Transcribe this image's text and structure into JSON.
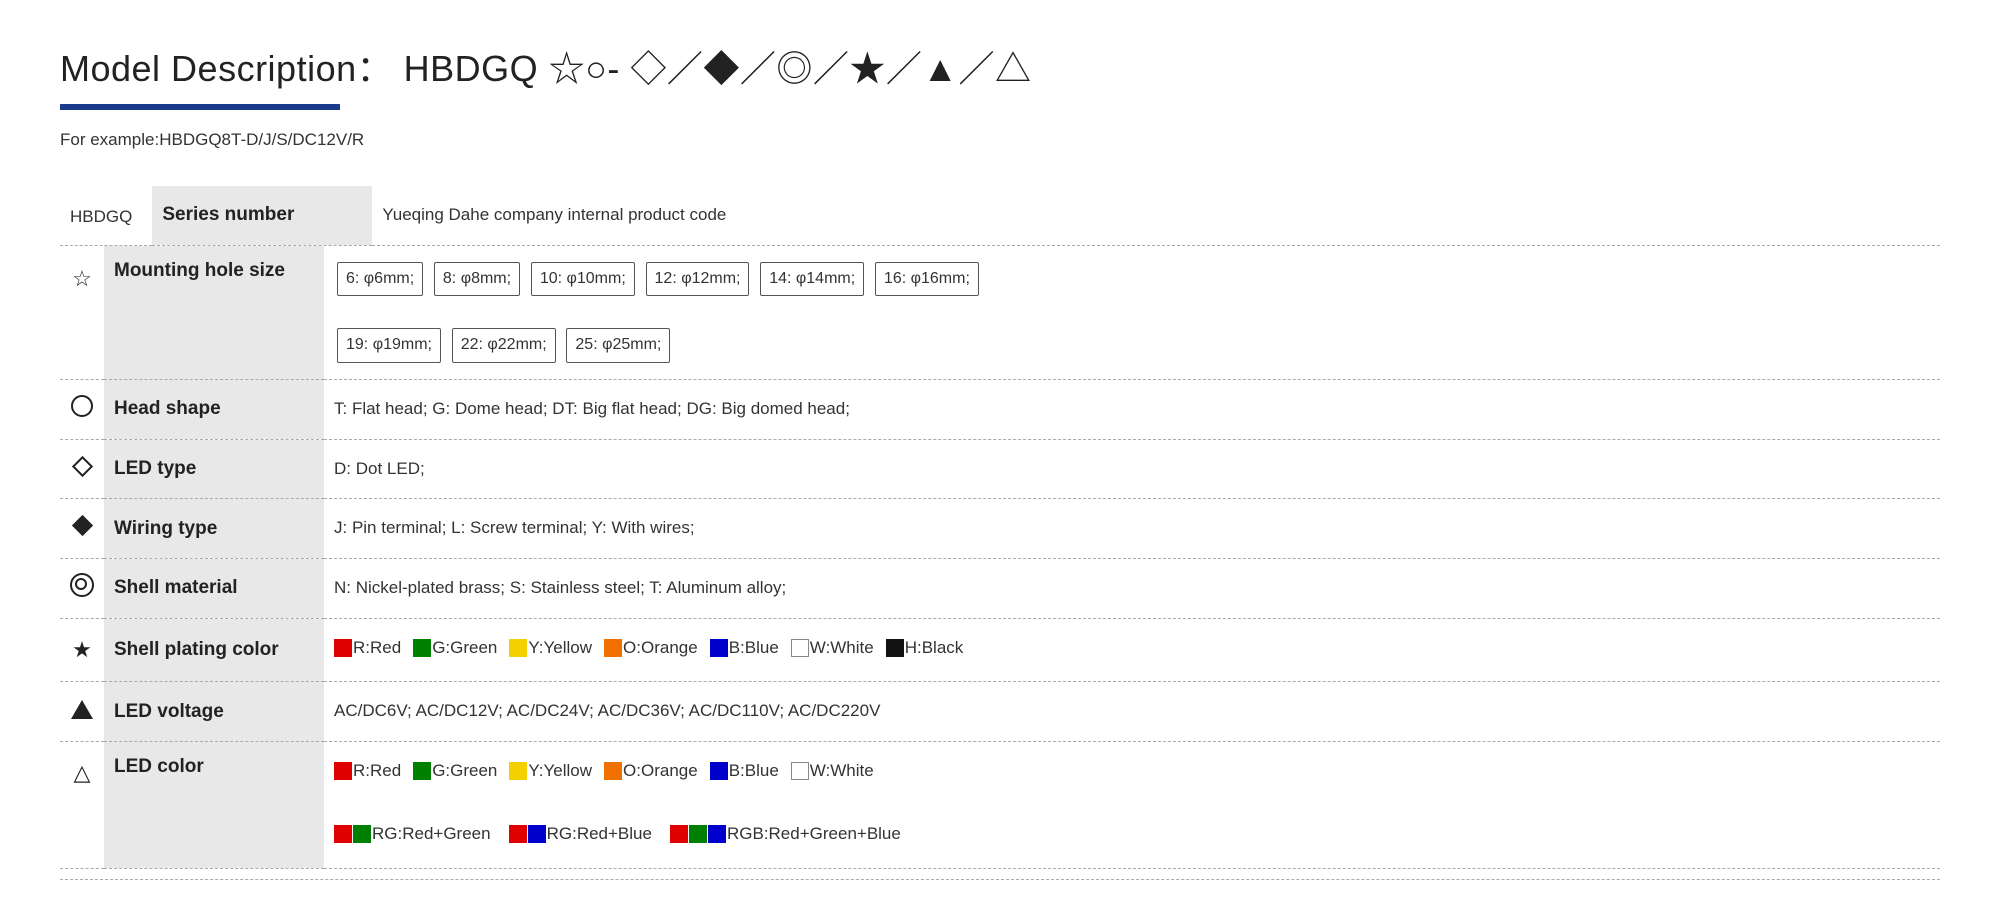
{
  "title": "Model Description： HBDGQ ☆○- ◇／◆／◎／★／▲／△",
  "progress_bar_color": "#1a3a8c",
  "example": "For example:HBDGQ8T-D/J/S/DC12V/R",
  "series": {
    "prefix": "HBDGQ",
    "label": "Series number",
    "description": "Yueqing Dahe company internal product code"
  },
  "rows": [
    {
      "id": "mounting-hole-size",
      "icon": "star-outline",
      "label": "Mounting hole size",
      "values_line1": [
        "6: φ6mm;",
        "8: φ8mm;",
        "10: φ10mm;",
        "12: φ12mm;",
        "14: φ14mm;",
        "16: φ16mm;"
      ],
      "values_line2": [
        "19: φ19mm;",
        "22: φ22mm;",
        "25: φ25mm;"
      ]
    },
    {
      "id": "head-shape",
      "icon": "circle",
      "label": "Head  shape",
      "value": "T: Flat head;   G: Dome head;   DT: Big flat head;   DG: Big domed head;"
    },
    {
      "id": "led-type",
      "icon": "diamond-outline",
      "label": "LED type",
      "value": "D: Dot LED;"
    },
    {
      "id": "wiring-type",
      "icon": "diamond-fill",
      "label": "Wiring type",
      "value": "J: Pin terminal;   L: Screw terminal;   Y: With wires;"
    },
    {
      "id": "shell-material",
      "icon": "circle-double",
      "label": "Shell material",
      "value": "N: Nickel-plated brass;   S: Stainless steel;   T: Aluminum alloy;"
    },
    {
      "id": "shell-plating-color",
      "icon": "star-fill",
      "label": "Shell plating color",
      "colors": [
        {
          "color": "#e00000",
          "label": "R:Red"
        },
        {
          "color": "#008000",
          "label": "G:Green"
        },
        {
          "color": "#f5d000",
          "label": "Y:Yellow"
        },
        {
          "color": "#f07000",
          "label": "O:Orange"
        },
        {
          "color": "#0000cc",
          "label": "B:Blue"
        },
        {
          "color": null,
          "label": "W:White",
          "outline": true
        },
        {
          "color": "#111111",
          "label": "H:Black"
        }
      ]
    },
    {
      "id": "led-voltage",
      "icon": "triangle-fill",
      "label": "LED voltage",
      "value": "AC/DC6V;   AC/DC12V;   AC/DC24V;   AC/DC36V;   AC/DC110V;   AC/DC220V"
    },
    {
      "id": "led-color",
      "icon": "triangle-outline",
      "label": "LED color",
      "colors": [
        {
          "color": "#e00000",
          "label": "R:Red"
        },
        {
          "color": "#008000",
          "label": "G:Green"
        },
        {
          "color": "#f5d000",
          "label": "Y:Yellow"
        },
        {
          "color": "#f07000",
          "label": "O:Orange"
        },
        {
          "color": "#0000cc",
          "label": "B:Blue"
        },
        {
          "color": null,
          "label": "W:White",
          "outline": true
        }
      ],
      "colors2": [
        {
          "swatches": [
            "#e00000",
            "#008000"
          ],
          "label": "RG:Red+Green"
        },
        {
          "swatches": [
            "#e00000",
            "#0000cc"
          ],
          "label": "RG:Red+Blue"
        },
        {
          "swatches": [
            "#e00000",
            "#008000",
            "#0000cc"
          ],
          "label": "RGB:Red+Green+Blue"
        }
      ]
    }
  ]
}
